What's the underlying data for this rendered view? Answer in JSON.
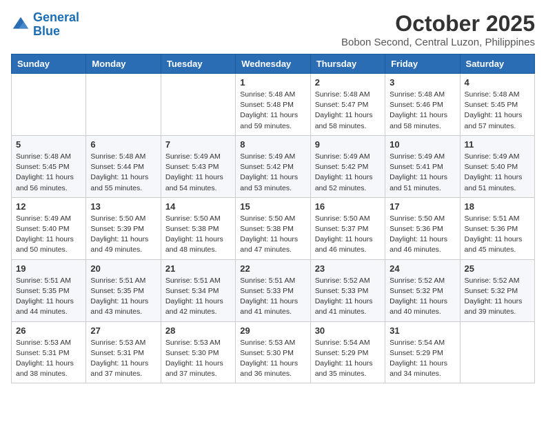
{
  "header": {
    "logo_line1": "General",
    "logo_line2": "Blue",
    "month": "October 2025",
    "location": "Bobon Second, Central Luzon, Philippines"
  },
  "days_of_week": [
    "Sunday",
    "Monday",
    "Tuesday",
    "Wednesday",
    "Thursday",
    "Friday",
    "Saturday"
  ],
  "weeks": [
    [
      {
        "day": "",
        "info": ""
      },
      {
        "day": "",
        "info": ""
      },
      {
        "day": "",
        "info": ""
      },
      {
        "day": "1",
        "info": "Sunrise: 5:48 AM\nSunset: 5:48 PM\nDaylight: 11 hours\nand 59 minutes."
      },
      {
        "day": "2",
        "info": "Sunrise: 5:48 AM\nSunset: 5:47 PM\nDaylight: 11 hours\nand 58 minutes."
      },
      {
        "day": "3",
        "info": "Sunrise: 5:48 AM\nSunset: 5:46 PM\nDaylight: 11 hours\nand 58 minutes."
      },
      {
        "day": "4",
        "info": "Sunrise: 5:48 AM\nSunset: 5:45 PM\nDaylight: 11 hours\nand 57 minutes."
      }
    ],
    [
      {
        "day": "5",
        "info": "Sunrise: 5:48 AM\nSunset: 5:45 PM\nDaylight: 11 hours\nand 56 minutes."
      },
      {
        "day": "6",
        "info": "Sunrise: 5:48 AM\nSunset: 5:44 PM\nDaylight: 11 hours\nand 55 minutes."
      },
      {
        "day": "7",
        "info": "Sunrise: 5:49 AM\nSunset: 5:43 PM\nDaylight: 11 hours\nand 54 minutes."
      },
      {
        "day": "8",
        "info": "Sunrise: 5:49 AM\nSunset: 5:42 PM\nDaylight: 11 hours\nand 53 minutes."
      },
      {
        "day": "9",
        "info": "Sunrise: 5:49 AM\nSunset: 5:42 PM\nDaylight: 11 hours\nand 52 minutes."
      },
      {
        "day": "10",
        "info": "Sunrise: 5:49 AM\nSunset: 5:41 PM\nDaylight: 11 hours\nand 51 minutes."
      },
      {
        "day": "11",
        "info": "Sunrise: 5:49 AM\nSunset: 5:40 PM\nDaylight: 11 hours\nand 51 minutes."
      }
    ],
    [
      {
        "day": "12",
        "info": "Sunrise: 5:49 AM\nSunset: 5:40 PM\nDaylight: 11 hours\nand 50 minutes."
      },
      {
        "day": "13",
        "info": "Sunrise: 5:50 AM\nSunset: 5:39 PM\nDaylight: 11 hours\nand 49 minutes."
      },
      {
        "day": "14",
        "info": "Sunrise: 5:50 AM\nSunset: 5:38 PM\nDaylight: 11 hours\nand 48 minutes."
      },
      {
        "day": "15",
        "info": "Sunrise: 5:50 AM\nSunset: 5:38 PM\nDaylight: 11 hours\nand 47 minutes."
      },
      {
        "day": "16",
        "info": "Sunrise: 5:50 AM\nSunset: 5:37 PM\nDaylight: 11 hours\nand 46 minutes."
      },
      {
        "day": "17",
        "info": "Sunrise: 5:50 AM\nSunset: 5:36 PM\nDaylight: 11 hours\nand 46 minutes."
      },
      {
        "day": "18",
        "info": "Sunrise: 5:51 AM\nSunset: 5:36 PM\nDaylight: 11 hours\nand 45 minutes."
      }
    ],
    [
      {
        "day": "19",
        "info": "Sunrise: 5:51 AM\nSunset: 5:35 PM\nDaylight: 11 hours\nand 44 minutes."
      },
      {
        "day": "20",
        "info": "Sunrise: 5:51 AM\nSunset: 5:35 PM\nDaylight: 11 hours\nand 43 minutes."
      },
      {
        "day": "21",
        "info": "Sunrise: 5:51 AM\nSunset: 5:34 PM\nDaylight: 11 hours\nand 42 minutes."
      },
      {
        "day": "22",
        "info": "Sunrise: 5:51 AM\nSunset: 5:33 PM\nDaylight: 11 hours\nand 41 minutes."
      },
      {
        "day": "23",
        "info": "Sunrise: 5:52 AM\nSunset: 5:33 PM\nDaylight: 11 hours\nand 41 minutes."
      },
      {
        "day": "24",
        "info": "Sunrise: 5:52 AM\nSunset: 5:32 PM\nDaylight: 11 hours\nand 40 minutes."
      },
      {
        "day": "25",
        "info": "Sunrise: 5:52 AM\nSunset: 5:32 PM\nDaylight: 11 hours\nand 39 minutes."
      }
    ],
    [
      {
        "day": "26",
        "info": "Sunrise: 5:53 AM\nSunset: 5:31 PM\nDaylight: 11 hours\nand 38 minutes."
      },
      {
        "day": "27",
        "info": "Sunrise: 5:53 AM\nSunset: 5:31 PM\nDaylight: 11 hours\nand 37 minutes."
      },
      {
        "day": "28",
        "info": "Sunrise: 5:53 AM\nSunset: 5:30 PM\nDaylight: 11 hours\nand 37 minutes."
      },
      {
        "day": "29",
        "info": "Sunrise: 5:53 AM\nSunset: 5:30 PM\nDaylight: 11 hours\nand 36 minutes."
      },
      {
        "day": "30",
        "info": "Sunrise: 5:54 AM\nSunset: 5:29 PM\nDaylight: 11 hours\nand 35 minutes."
      },
      {
        "day": "31",
        "info": "Sunrise: 5:54 AM\nSunset: 5:29 PM\nDaylight: 11 hours\nand 34 minutes."
      },
      {
        "day": "",
        "info": ""
      }
    ]
  ]
}
